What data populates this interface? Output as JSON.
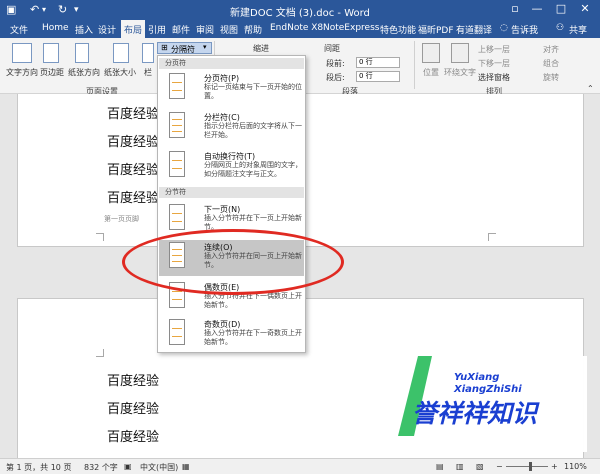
{
  "titlebar": {
    "file_name": "新建DOC 文档 (3).doc",
    "separator": " - ",
    "app_name": "Word",
    "controls": [
      "▫",
      "—",
      "□",
      "✕"
    ]
  },
  "tabs": {
    "file": "文件",
    "home": "Home",
    "insert": "插入",
    "design": "设计",
    "layout": "布局",
    "references": "引用",
    "mailings": "邮件",
    "review": "审阅",
    "view": "视图",
    "help": "帮助",
    "endnote": "EndNote X8",
    "noteexpress": "NoteExpress",
    "features": "特色功能",
    "pdf": "福昕PDF",
    "translate": "有道翻译",
    "tell_me": "告诉我",
    "share": "共享"
  },
  "ribbon": {
    "text_direction": "文字方向",
    "margins": "页边距",
    "orientation": "纸张方向",
    "size": "纸张大小",
    "columns": "栏",
    "breaks_button": "分隔符",
    "group_page_setup": "页面设置",
    "indent_label": "缩进",
    "spacing_label": "间距",
    "before_label": "段前:",
    "before_value": "0 行",
    "after_label": "段后:",
    "after_value": "0 行",
    "group_paragraph": "段落",
    "position": "位置",
    "wrap_text": "环绕文字",
    "bring_forward": "上移一层",
    "send_backward": "下移一层",
    "selection_pane": "选择窗格",
    "align": "对齐",
    "group": "组合",
    "rotate": "旋转",
    "group_arrange": "排列"
  },
  "document": {
    "page1_lines": [
      "百度经验",
      "百度经验",
      "百度经验",
      "百度经验"
    ],
    "page1_footer": "第一页页脚",
    "page2_lines": [
      "百度经验",
      "百度经验",
      "百度经验"
    ]
  },
  "dropdown": {
    "header_page_breaks": "分页符",
    "header_section_breaks": "分节符",
    "items": [
      {
        "title": "分页符(P)",
        "desc": "标记一页结束与下一页开始的位置。"
      },
      {
        "title": "分栏符(C)",
        "desc": "指示分栏符后面的文字将从下一栏开始。"
      },
      {
        "title": "自动换行符(T)",
        "desc": "分隔网页上的对象周围的文字，如分隔题注文字与正文。"
      },
      {
        "title": "下一页(N)",
        "desc": "插入分节符并在下一页上开始新节。"
      },
      {
        "title": "连续(O)",
        "desc": "插入分节符并在同一页上开始新节。"
      },
      {
        "title": "偶数页(E)",
        "desc": "插入分节符并在下一偶数页上开始新节。"
      },
      {
        "title": "奇数页(D)",
        "desc": "插入分节符并在下一奇数页上开始新节。"
      }
    ]
  },
  "status": {
    "page": "第 1 页，共 10 页",
    "words": "832 个字",
    "language": "中文(中国)",
    "zoom": "110%"
  },
  "watermark": {
    "brand_line1": "YuXiang",
    "brand_line2": "XiangZhiShi",
    "brand_cn": "誉祥祥知识"
  },
  "colors": {
    "accent": "#2b579a",
    "highlight": "#c6c6c6",
    "annotation_red": "#e02a22",
    "watermark_blue": "#1a3fd1",
    "watermark_green": "#3cc26a"
  }
}
